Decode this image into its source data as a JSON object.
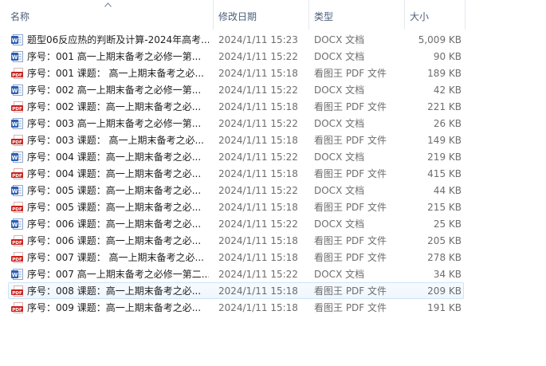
{
  "columns": {
    "name": "名称",
    "date": "修改日期",
    "type": "类型",
    "size": "大小"
  },
  "files": [
    {
      "icon": "word-doc-icon",
      "name": "题型06反应热的判断及计算-2024年高考...",
      "date": "2024/1/11 15:23",
      "type": "DOCX 文档",
      "size": "5,009 KB"
    },
    {
      "icon": "word-doc-icon",
      "name": "序号：001  高一上期末备考之必修一第...",
      "date": "2024/1/11 15:22",
      "type": "DOCX 文档",
      "size": "90 KB"
    },
    {
      "icon": "pdf-icon",
      "name": "序号：001 课题： 高一上期末备考之必...",
      "date": "2024/1/11 15:18",
      "type": "看图王 PDF 文件",
      "size": "189 KB"
    },
    {
      "icon": "word-doc-icon",
      "name": "序号：002  高一上期末备考之必修一第...",
      "date": "2024/1/11 15:22",
      "type": "DOCX 文档",
      "size": "42 KB"
    },
    {
      "icon": "pdf-icon",
      "name": "序号：002  课题：高一上期末备考之必...",
      "date": "2024/1/11 15:18",
      "type": "看图王 PDF 文件",
      "size": "221 KB"
    },
    {
      "icon": "word-doc-icon",
      "name": "序号：003  高一上期末备考之必修一第...",
      "date": "2024/1/11 15:22",
      "type": "DOCX 文档",
      "size": "26 KB"
    },
    {
      "icon": "pdf-icon",
      "name": "序号：003  课题：  高一上期末备考之必...",
      "date": "2024/1/11 15:18",
      "type": "看图王 PDF 文件",
      "size": "149 KB"
    },
    {
      "icon": "word-doc-icon",
      "name": "序号：004   课题：高一上期末备考之必...",
      "date": "2024/1/11 15:22",
      "type": "DOCX 文档",
      "size": "219 KB"
    },
    {
      "icon": "pdf-icon",
      "name": "序号：004   课题：高一上期末备考之必...",
      "date": "2024/1/11 15:18",
      "type": "看图王 PDF 文件",
      "size": "415 KB"
    },
    {
      "icon": "word-doc-icon",
      "name": "序号：005  课题：高一上期末备考之必...",
      "date": "2024/1/11 15:22",
      "type": "DOCX 文档",
      "size": "44 KB"
    },
    {
      "icon": "pdf-icon",
      "name": "序号：005  课题：高一上期末备考之必...",
      "date": "2024/1/11 15:18",
      "type": "看图王 PDF 文件",
      "size": "215 KB"
    },
    {
      "icon": "word-doc-icon",
      "name": "序号：006  课题：高一上期末备考之必...",
      "date": "2024/1/11 15:22",
      "type": "DOCX 文档",
      "size": "25 KB"
    },
    {
      "icon": "pdf-icon",
      "name": "序号：006  课题：高一上期末备考之必...",
      "date": "2024/1/11 15:18",
      "type": "看图王 PDF 文件",
      "size": "205 KB"
    },
    {
      "icon": "pdf-icon",
      "name": "序号：007  课题： 高一上期末备考之必...",
      "date": "2024/1/11 15:18",
      "type": "看图王 PDF 文件",
      "size": "278 KB"
    },
    {
      "icon": "word-doc-icon",
      "name": "序号：007 高一上期末备考之必修一第二...",
      "date": "2024/1/11 15:22",
      "type": "DOCX 文档",
      "size": "34 KB"
    },
    {
      "icon": "pdf-icon",
      "name": "序号：008  课题：高一上期末备考之必...",
      "date": "2024/1/11 15:18",
      "type": "看图王 PDF 文件",
      "size": "209 KB",
      "selected": true
    },
    {
      "icon": "pdf-icon",
      "name": "序号：009  课题：高一上期末备考之必...",
      "date": "2024/1/11 15:18",
      "type": "看图王 PDF 文件",
      "size": "191 KB"
    }
  ],
  "colors": {
    "header_text": "#4c607a",
    "word_icon": "#2b5fb4",
    "pdf_icon": "#c8221c",
    "selection_border": "#d0e3f5"
  }
}
